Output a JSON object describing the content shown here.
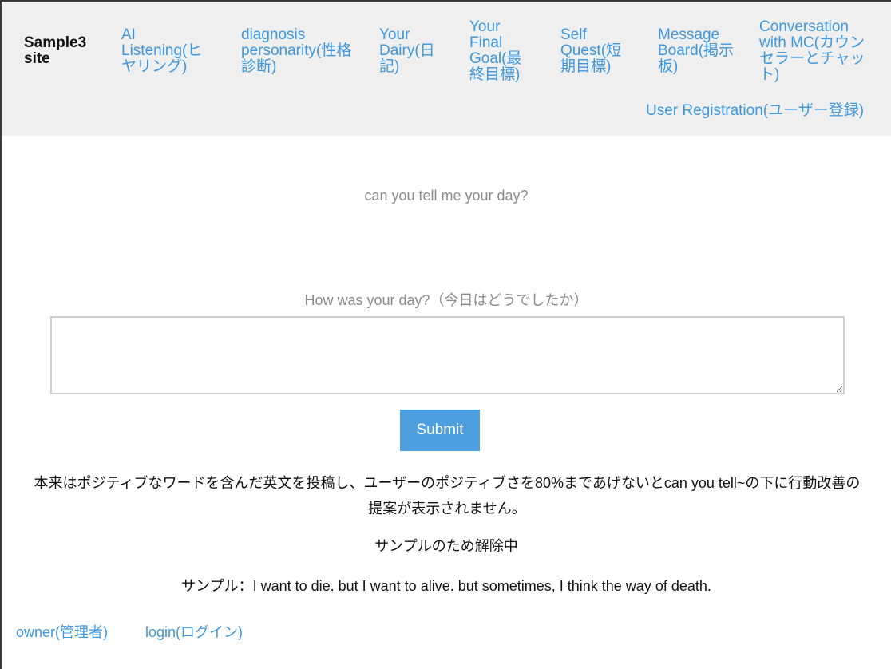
{
  "nav": {
    "brand": "Sample3 site",
    "links": [
      "AI Listening(ヒヤリング)",
      "diagnosis personarity(性格診断)",
      "Your Dairy(日記)",
      "Your Final Goal(最終目標)",
      "Self Quest(短期目標)",
      "Message Board(掲示板)",
      "Conversation with MC(カウンセラーとチャット)"
    ],
    "register": "User Registration(ユーザー登録)"
  },
  "main": {
    "prompt": "can you tell me your day?",
    "input_label": "How was your day?（今日はどうでしたか）",
    "input_value": "",
    "submit_label": "Submit",
    "note": "本来はポジティブなワードを含んだ英文を投稿し、ユーザーのポジティブさを80%まであげないとcan you tell~の下に行動改善の提案が表示されません。",
    "unlock_note": "サンプルのため解除中",
    "sample_text": "サンプル：I want to die. but I want to alive. but sometimes, I think the way of death."
  },
  "footer": {
    "owner": "owner(管理者)",
    "login": "login(ログイン)"
  },
  "colors": {
    "link": "#3d97dd",
    "button": "#4d9fe0",
    "navbar_bg": "#efefef"
  }
}
